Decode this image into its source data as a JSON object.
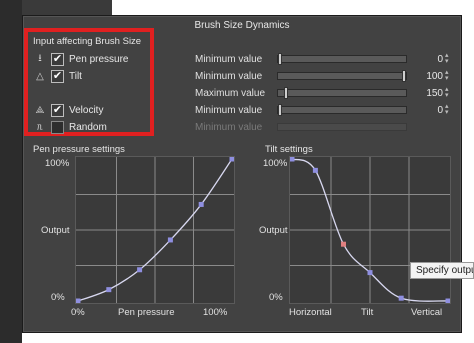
{
  "dialog": {
    "title": "Brush Size Dynamics",
    "input_group_label": "Input affecting Brush Size",
    "inputs": [
      {
        "icon": "pen-pressure-icon",
        "glyph": "⭳",
        "label": "Pen pressure",
        "checked": true,
        "check_glyph": "✔"
      },
      {
        "icon": "tilt-icon",
        "glyph": "△",
        "label": "Tilt",
        "checked": true,
        "check_glyph": "✔"
      },
      {
        "icon": "velocity-icon",
        "glyph": "⟁",
        "label": "Velocity",
        "checked": true,
        "check_glyph": "✔"
      },
      {
        "icon": "random-icon",
        "glyph": "ᥰ",
        "label": "Random",
        "checked": false,
        "check_glyph": ""
      }
    ],
    "params": [
      {
        "label": "Minimum value",
        "value": "0",
        "level": 0,
        "enabled": true
      },
      {
        "label": "Minimum value",
        "value": "100",
        "level": 1,
        "enabled": true
      },
      {
        "label": "Maximum value",
        "value": "150",
        "level": 0.05,
        "enabled": true
      },
      {
        "label": "Minimum value",
        "value": "0",
        "level": 0,
        "enabled": true
      },
      {
        "label": "Minimum value",
        "value": "",
        "level": 0,
        "enabled": false
      }
    ],
    "pen_graph": {
      "title": "Pen pressure settings",
      "y_top": "100%",
      "y_mid": "Output",
      "y_bottom": "0%",
      "x_left": "0%",
      "x_mid": "Pen pressure",
      "x_right": "100%",
      "points": [
        [
          0,
          0
        ],
        [
          0.2,
          0.08
        ],
        [
          0.4,
          0.22
        ],
        [
          0.6,
          0.43
        ],
        [
          0.8,
          0.68
        ],
        [
          1,
          1
        ]
      ]
    },
    "tilt_graph": {
      "title": "Tilt settings",
      "y_top": "100%",
      "y_mid": "Output",
      "y_bottom": "0%",
      "x_left": "Horizontal",
      "x_mid": "Tilt",
      "x_right": "Vertical",
      "points": [
        [
          0,
          1
        ],
        [
          0.15,
          0.92
        ],
        [
          0.33,
          0.4
        ],
        [
          0.5,
          0.2
        ],
        [
          0.7,
          0.02
        ],
        [
          1,
          0
        ]
      ],
      "highlight_index": 2
    },
    "tooltip": "Specify output"
  },
  "colors": {
    "highlight": "#e02020",
    "curve": "#d8d8f0",
    "control_point": "#8f8fe0",
    "active_point": "#e08080"
  }
}
